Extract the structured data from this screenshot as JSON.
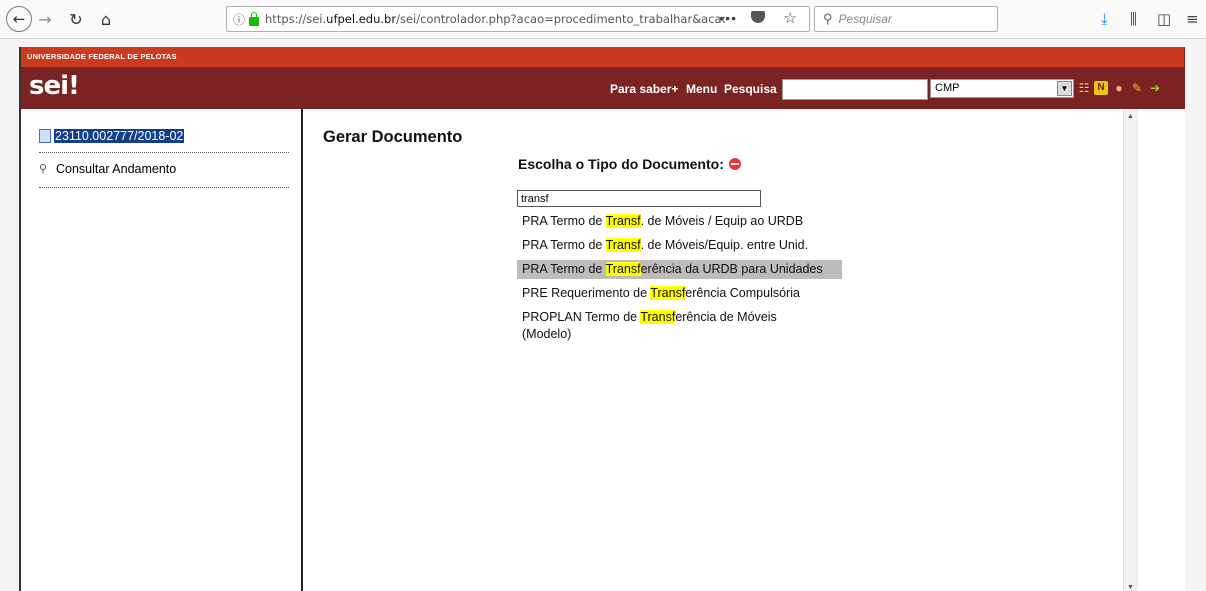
{
  "browser": {
    "url_prefix": "https://sei.",
    "url_domain": "ufpel.edu.br",
    "url_rest": "/sei/controlador.php?acao=procedimento_trabalhar&acao...",
    "search_placeholder": "Pesquisar",
    "icons": [
      "back-icon",
      "forward-icon",
      "reload-icon",
      "home-icon",
      "info-icon",
      "lock-icon",
      "more-icon",
      "pocket-icon",
      "bookmark-star-icon",
      "search-icon",
      "download-icon",
      "library-icon",
      "sidebar-icon",
      "menu-icon"
    ]
  },
  "header": {
    "university": "UNIVERSIDADE FEDERAL DE PELOTAS",
    "logo": "sei!",
    "links": [
      "Para saber+",
      "Menu",
      "Pesquisa"
    ],
    "search_value": "",
    "unit_selected": "CMP",
    "colors": {
      "topband": "#c93a1f",
      "header": "#7b2322"
    }
  },
  "left": {
    "process_number": "23110.002777/2018-02",
    "consult_label": "Consultar Andamento"
  },
  "main": {
    "title": "Gerar Documento",
    "subtitle": "Escolha o Tipo do Documento:",
    "filter_value": "transf",
    "options": [
      {
        "pre": "PRA Termo de ",
        "hl": "Transf",
        "post": ". de Móveis / Equip ao URDB",
        "selected": false
      },
      {
        "pre": "PRA Termo de ",
        "hl": "Transf",
        "post": ". de Móveis/Equip. entre Unid.",
        "selected": false
      },
      {
        "pre": "PRA Termo de ",
        "hl": "Transf",
        "post": "erência da URDB para Unidades",
        "selected": true
      },
      {
        "pre": "PRE Requerimento de ",
        "hl": "Transf",
        "post": "erência Compulsória",
        "selected": false
      },
      {
        "pre": "PROPLAN Termo de ",
        "hl": "Transf",
        "post": "erência de Móveis (Modelo)",
        "selected": false
      }
    ]
  }
}
